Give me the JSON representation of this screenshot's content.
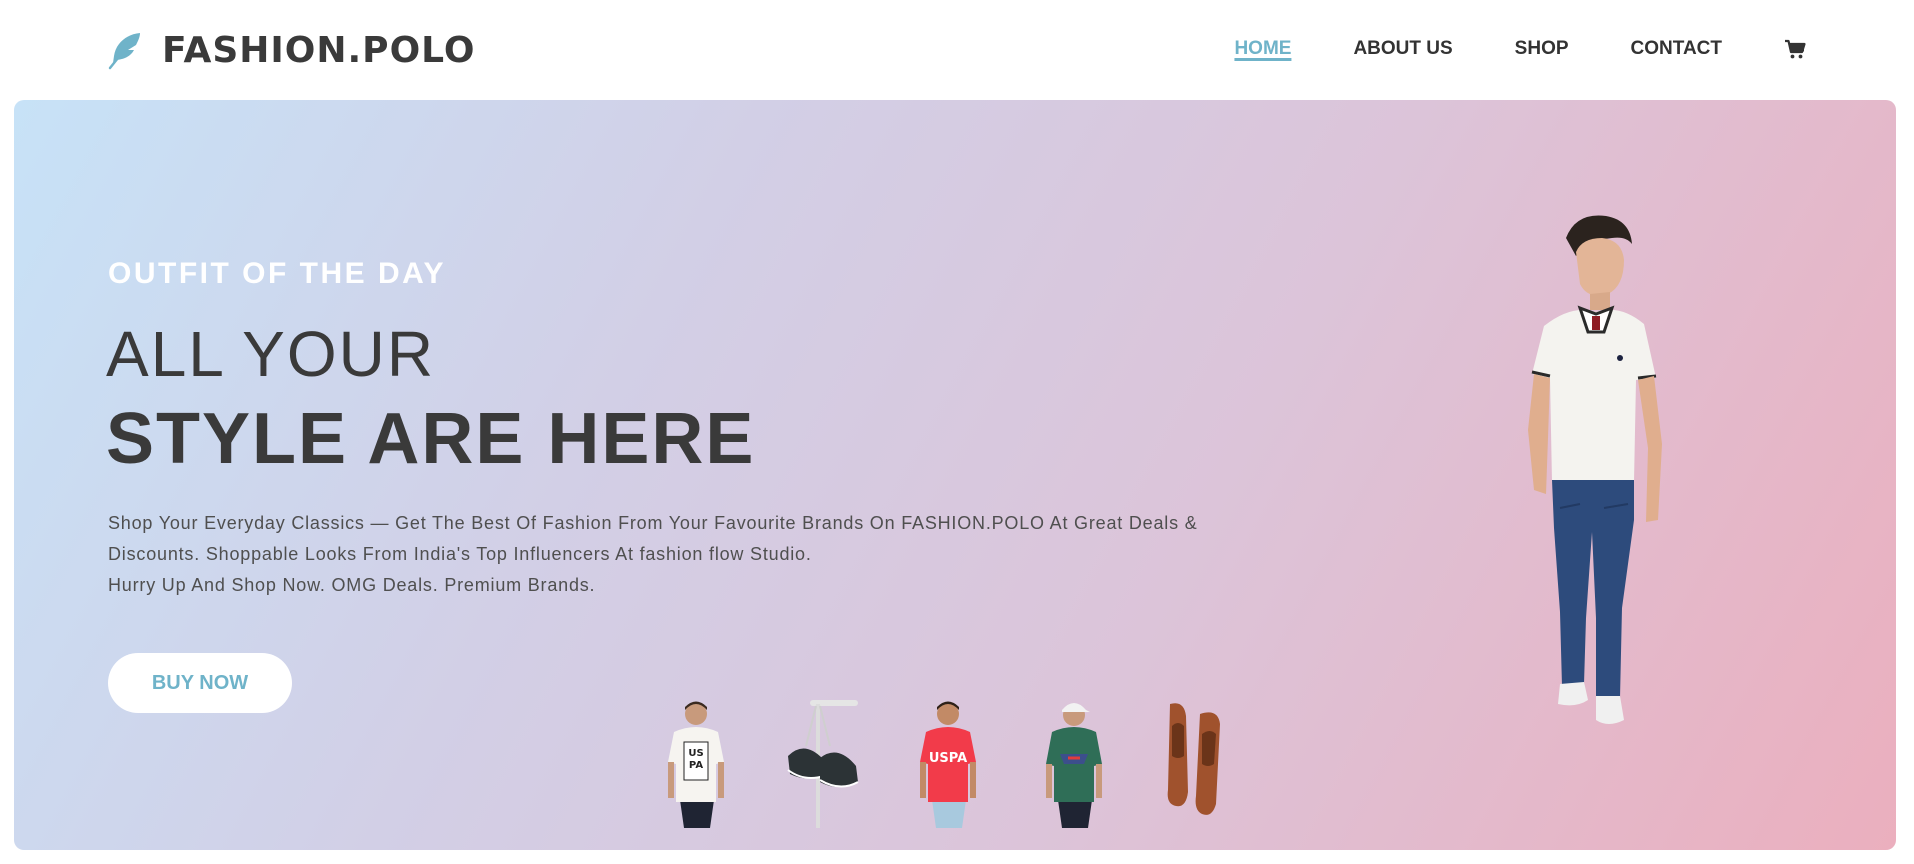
{
  "brand": {
    "name": "FASHION.POLO",
    "logo_icon": "feather-icon",
    "accent_color": "#6fb3c9"
  },
  "nav": {
    "items": [
      {
        "label": "HOME",
        "active": true
      },
      {
        "label": "ABOUT US",
        "active": false
      },
      {
        "label": "SHOP",
        "active": false
      },
      {
        "label": "CONTACT",
        "active": false
      }
    ],
    "cart_icon": "cart-icon"
  },
  "hero": {
    "eyebrow": "OUTFIT OF THE DAY",
    "title_line1": "ALL YOUR",
    "title_line2": "STYLE ARE HERE",
    "description_line1": "Shop Your Everyday Classics — Get The Best Of Fashion From Your Favourite Brands On FASHION.POLO At Great Deals &",
    "description_line2": "Discounts. Shoppable Looks From India's Top Influencers At fashion flow Studio.",
    "description_line3": "Hurry Up And Shop Now. OMG Deals. Premium Brands.",
    "cta_label": "BUY NOW",
    "gradient_colors": [
      "#c7e2f7",
      "#d2cfe6",
      "#dcc4d9",
      "#ebafbe"
    ]
  },
  "thumbnails": [
    {
      "name": "white-uspa-tshirt-thumbnail"
    },
    {
      "name": "black-sneakers-thumbnail"
    },
    {
      "name": "red-uspa-tshirt-thumbnail"
    },
    {
      "name": "green-tshirt-cap-thumbnail"
    },
    {
      "name": "brown-shoes-thumbnail"
    }
  ],
  "featured_model": {
    "name": "model-white-polo-jeans-image"
  }
}
